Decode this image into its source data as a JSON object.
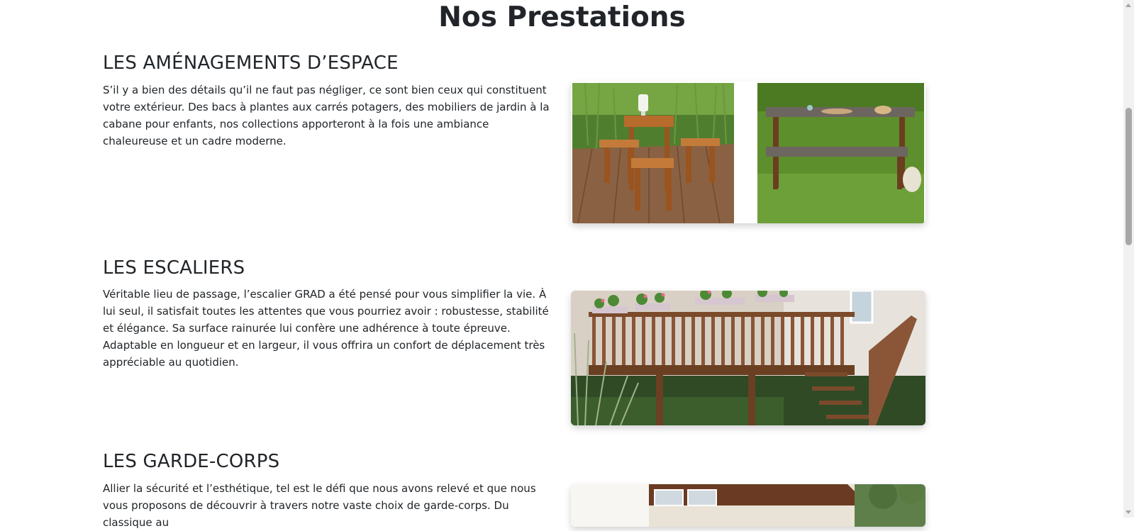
{
  "page": {
    "title": "Nos Prestations"
  },
  "sections": [
    {
      "title": "LES AMÉNAGEMENTS D’ESPACE",
      "text": "S’il y a bien des détails qu’il ne faut pas négliger, ce sont bien ceux qui constituent votre extérieur. Des bacs à plantes aux carrés potagers, des mobiliers de jardin à la cabane pour enfants, nos collections apporteront à la fois une ambiance chaleureuse et un cadre moderne."
    },
    {
      "title": "LES ESCALIERS",
      "text": "Véritable lieu de passage, l’escalier GRAD a été pensé pour vous simplifier la vie. À lui seul, il satisfait toutes les attentes que vous pourriez avoir : robustesse, stabilité et élégance. Sa surface rainurée lui confère une adhérence à toute épreuve. Adaptable en longueur et en largeur, il vous offrira un confort de déplacement très appréciable au quotidien."
    },
    {
      "title": "LES GARDE-CORPS",
      "text": "Allier la sécurité et l’esthétique, tel est le défi que nous avons relevé et que nous vous proposons de découvrir à travers notre vaste choix de garde-corps. Du classique au"
    }
  ]
}
